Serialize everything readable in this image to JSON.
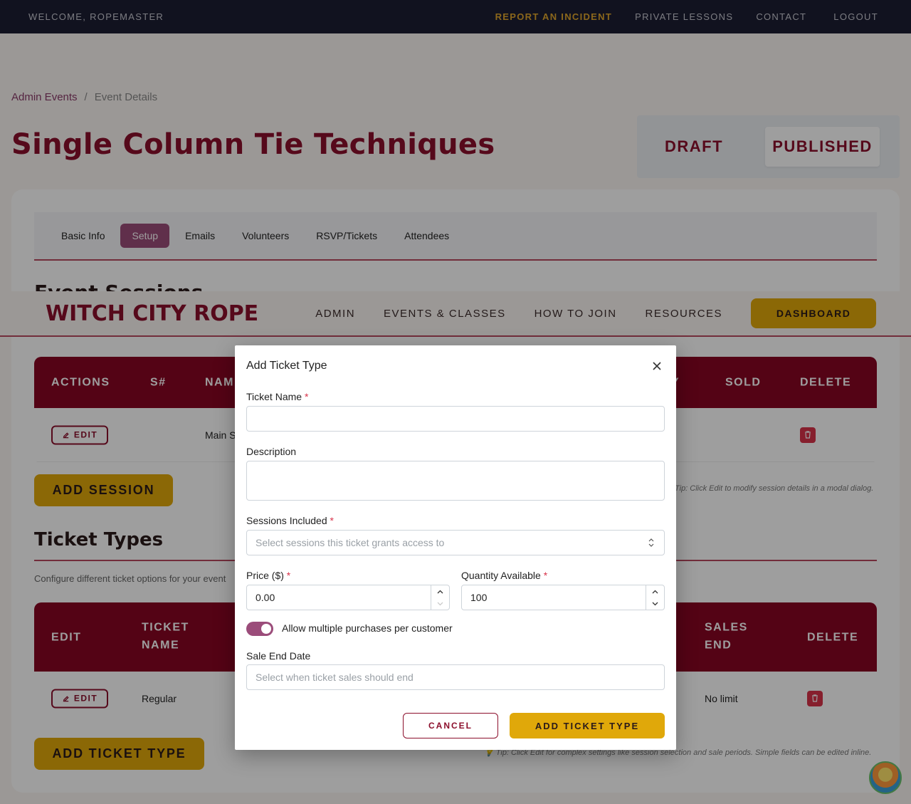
{
  "utility_bar": {
    "welcome": "WELCOME, ROPEMASTER",
    "report": "REPORT AN INCIDENT",
    "lessons": "PRIVATE LESSONS",
    "contact": "CONTACT",
    "logout": "LOGOUT"
  },
  "breadcrumb": {
    "parent": "Admin Events",
    "separator": "/",
    "current": "Event Details"
  },
  "page_title": "Single Column Tie Techniques",
  "status_toggle": {
    "draft": "DRAFT",
    "published": "PUBLISHED",
    "selected": "PUBLISHED"
  },
  "tabs": [
    "Basic Info",
    "Setup",
    "Emails",
    "Volunteers",
    "RSVP/Tickets",
    "Attendees"
  ],
  "active_tab": "Setup",
  "sessions_section": {
    "title_peek": "Event Sessions"
  },
  "main_nav": {
    "brand": "WITCH CITY ROPE",
    "links": [
      "ADMIN",
      "EVENTS & CLASSES",
      "HOW TO JOIN",
      "RESOURCES"
    ],
    "dashboard": "DASHBOARD"
  },
  "sessions_table": {
    "headers": {
      "actions": "ACTIONS",
      "snum": "S#",
      "name": "NAM",
      "capacity": "Y",
      "sold": "SOLD",
      "delete": "DELETE"
    },
    "row": {
      "edit": "EDIT",
      "name": "Main Se"
    },
    "add_button": "ADD SESSION",
    "tip": "Tip: Click Edit to modify session details in a modal dialog."
  },
  "ticket_section": {
    "title": "Ticket Types",
    "description": "Configure different ticket options for your event"
  },
  "ticket_table": {
    "headers": {
      "edit": "EDIT",
      "name_1": "TICKET",
      "name_2": "NAME",
      "sales_end_1": "SALES",
      "sales_end_2": "END",
      "delete": "DELETE"
    },
    "row": {
      "edit": "EDIT",
      "name": "Regular",
      "sales_end": "No limit"
    },
    "add_button": "ADD TICKET TYPE",
    "tip": "💡 Tip: Click Edit for complex settings like session selection and sale periods. Simple fields can be edited inline."
  },
  "modal": {
    "title": "Add Ticket Type",
    "ticket_name_label": "Ticket Name",
    "ticket_name_value": "",
    "description_label": "Description",
    "description_value": "",
    "sessions_label": "Sessions Included",
    "sessions_placeholder": "Select sessions this ticket grants access to",
    "price_label": "Price ($)",
    "price_value": "0.00",
    "quantity_label": "Quantity Available",
    "quantity_value": "100",
    "multiple_label": "Allow multiple purchases per customer",
    "multiple_enabled": true,
    "sale_end_label": "Sale End Date",
    "sale_end_placeholder": "Select when ticket sales should end",
    "required_mark": "*",
    "cancel": "CANCEL",
    "submit": "ADD TICKET TYPE"
  },
  "colors": {
    "brand": "#8c0f2c",
    "accent_gold": "#e0a80a",
    "tab_active": "#9b4c7a",
    "topbar": "#1c1e33"
  }
}
